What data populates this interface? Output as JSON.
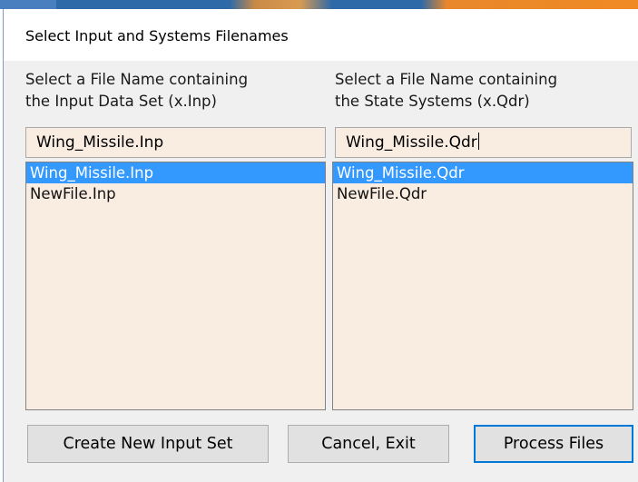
{
  "dialog": {
    "title": "Select Input and Systems Filenames"
  },
  "input_column": {
    "label_line1": "Select a File Name containing",
    "label_line2": "the Input Data Set (x.Inp)",
    "field_value": "Wing_Missile.Inp",
    "items": [
      {
        "label": "Wing_Missile.Inp",
        "selected": true
      },
      {
        "label": "NewFile.Inp",
        "selected": false
      }
    ]
  },
  "systems_column": {
    "label_line1": "Select a File Name containing",
    "label_line2": "the State Systems (x.Qdr)",
    "field_value": "Wing_Missile.Qdr",
    "items": [
      {
        "label": "Wing_Missile.Qdr",
        "selected": true
      },
      {
        "label": "NewFile.Qdr",
        "selected": false
      }
    ]
  },
  "buttons": {
    "create_label": "Create New Input Set",
    "cancel_label": "Cancel, Exit",
    "process_label": "Process Files"
  },
  "colors": {
    "selection": "#3399ff",
    "field_background": "#f9ece0",
    "dialog_background": "#f0f0f0",
    "default_button_border": "#0078d7"
  }
}
